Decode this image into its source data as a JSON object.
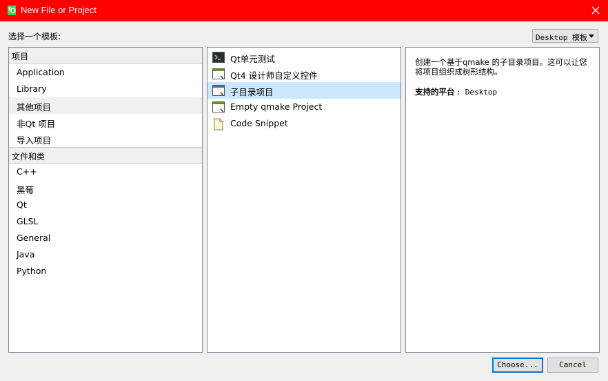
{
  "window": {
    "title": "New File or Project"
  },
  "prompt_label": "选择一个模板:",
  "filter": {
    "value": "Desktop 模板"
  },
  "categories": {
    "groups": [
      {
        "header": "项目",
        "items": [
          "Application",
          "Library",
          "其他项目",
          "非Qt 项目",
          "导入项目"
        ],
        "selected": "其他项目"
      },
      {
        "header": "文件和类",
        "items": [
          "C++",
          "黑莓",
          "Qt",
          "GLSL",
          "General",
          "Java",
          "Python"
        ]
      }
    ]
  },
  "templates": {
    "items": [
      {
        "label": "Qt单元测试",
        "icon": "terminal-icon"
      },
      {
        "label": "Qt4 设计师自定义控件",
        "icon": "window-icon"
      },
      {
        "label": "子目录项目",
        "icon": "subdirs-window-icon",
        "selected": true
      },
      {
        "label": "Empty qmake Project",
        "icon": "window-icon"
      },
      {
        "label": "Code Snippet",
        "icon": "document-icon"
      }
    ]
  },
  "description": {
    "line1": "创建一个基于qmake 的子目录项目。这可以让您",
    "line2": "将项目组织成树形结构。",
    "platforms_label": "支持的平台",
    "platforms_value": ": Desktop"
  },
  "buttons": {
    "choose": "Choose...",
    "cancel": "Cancel"
  },
  "colors": {
    "titlebar": "#ff0000",
    "selection": "#cce8ff",
    "default_button_border": "#0078d7"
  }
}
